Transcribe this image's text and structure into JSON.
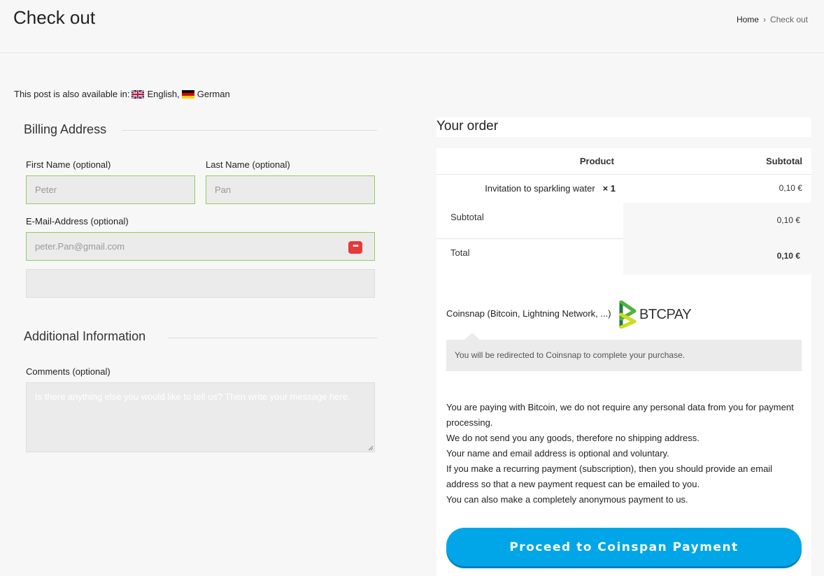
{
  "header": {
    "title": "Check out",
    "breadcrumb": {
      "home": "Home",
      "current": "Check out"
    }
  },
  "language_note": {
    "text": "This post is also available in:",
    "languages": [
      "English,",
      "German"
    ]
  },
  "billing": {
    "title": "Billing Address",
    "first_name": {
      "label": "First Name (optional)",
      "value": "Peter"
    },
    "last_name": {
      "label": "Last Name (optional)",
      "value": "Pan"
    },
    "email": {
      "label": "E-Mail-Address (optional)",
      "value": "peter.Pan@gmail.com"
    },
    "extra_value": ""
  },
  "additional": {
    "title": "Additional Information",
    "comments": {
      "label": "Comments (optional)",
      "placeholder": "Is there anything else you would like to tell us? Then write your message here."
    }
  },
  "order": {
    "title": "Your order",
    "headers": {
      "product": "Product",
      "subtotal": "Subtotal"
    },
    "item": {
      "name": "Invitation to sparkling water",
      "qty": "× 1",
      "price": "0,10 €"
    },
    "subtotal": {
      "label": "Subtotal",
      "value": "0,10 €"
    },
    "total": {
      "label": "Total",
      "value": "0,10 €"
    }
  },
  "payment": {
    "method_label": "Coinsnap (Bitcoin, Lightning Network, ...)",
    "logo_text": "BTCPAY",
    "notice": "You will be redirected to Coinsnap to complete your purchase.",
    "info_lines": [
      "You are paying with Bitcoin, we do not require any personal data from you for payment processing.",
      "We do not send you any goods, therefore no shipping address.",
      "Your name and email address is optional and voluntary.",
      "If you make a recurring payment (subscription), then you should provide an email address so that a new payment request can be emailed to you.",
      "You can also make a completely anonymous payment to us."
    ],
    "button_label": "Proceed to Coinspan Payment"
  },
  "colors": {
    "accent": "#00a6e8",
    "valid_border": "#8fce5f",
    "password_icon": "#e53a3a",
    "btcpay_green": "#51b13e"
  }
}
